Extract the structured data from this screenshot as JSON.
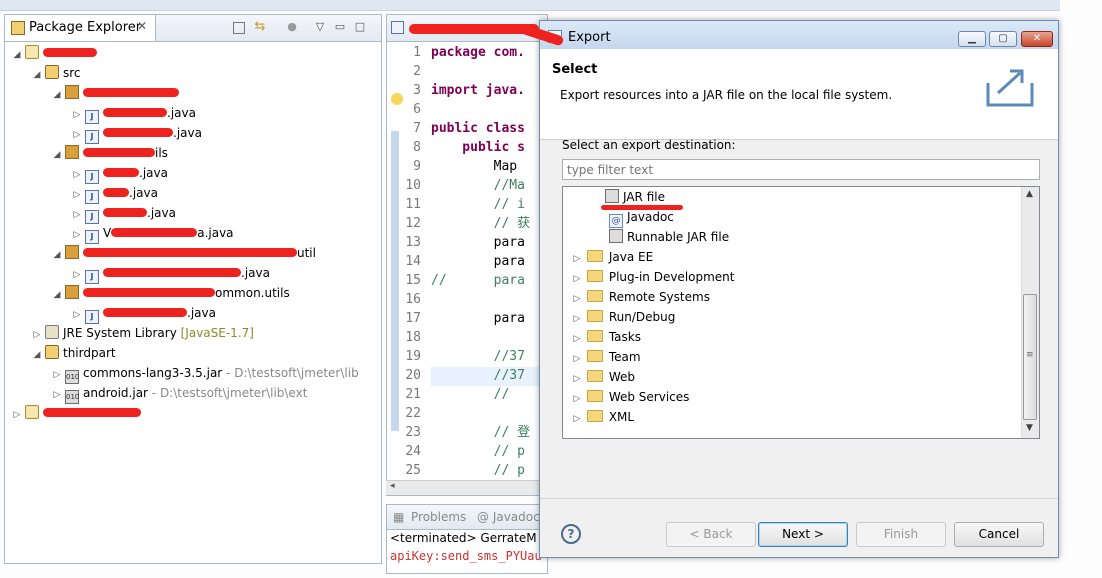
{
  "package_explorer": {
    "title": "Package Explorer",
    "src_label": "src",
    "files": {
      "f1": ".java",
      "f2": ".java",
      "f3": ".java",
      "f4": ".java",
      "f5": ".java",
      "f6_prefix": "V",
      "f6_suffix": "a.java",
      "f7": ".java",
      "f8": ".java"
    },
    "packages": {
      "p2_suffix": "ils",
      "p3_suffix": "util",
      "p4_suffix": "ommon.utils"
    },
    "jre_label": "JRE System Library",
    "jre_version": "[JavaSE-1.7]",
    "thirdpart_label": "thirdpart",
    "jar1_name": "commons-lang3-3.5.jar",
    "jar1_path": " - D:\\testsoft\\jmeter\\lib",
    "jar2_name": "android.jar",
    "jar2_path": " - D:\\testsoft\\jmeter\\lib\\ext"
  },
  "editor": {
    "lines": [
      {
        "n": "1",
        "code": "package com."
      },
      {
        "n": "2",
        "code": ""
      },
      {
        "n": "3",
        "code": "import java."
      },
      {
        "n": "6",
        "code": ""
      },
      {
        "n": "7",
        "code": "public class"
      },
      {
        "n": "8",
        "code": "    public s"
      },
      {
        "n": "9",
        "code": "        Map"
      },
      {
        "n": "10",
        "code": "        //Ma"
      },
      {
        "n": "11",
        "code": "        // i"
      },
      {
        "n": "12",
        "code": "        // 获"
      },
      {
        "n": "13",
        "code": "        para"
      },
      {
        "n": "14",
        "code": "        para"
      },
      {
        "n": "15",
        "code": "//      para"
      },
      {
        "n": "16",
        "code": ""
      },
      {
        "n": "17",
        "code": "        para"
      },
      {
        "n": "18",
        "code": ""
      },
      {
        "n": "19",
        "code": "        //37"
      },
      {
        "n": "20",
        "code": "        //37"
      },
      {
        "n": "21",
        "code": "        //"
      },
      {
        "n": "22",
        "code": ""
      },
      {
        "n": "23",
        "code": "        // 登"
      },
      {
        "n": "24",
        "code": "        // p"
      },
      {
        "n": "25",
        "code": "        // p"
      }
    ],
    "bottom_tabs": [
      "Problems",
      "@ Javadoc"
    ],
    "console_line1": "<terminated> GerrateM",
    "console_line2": "apiKey:send_sms_PYUau"
  },
  "dialog": {
    "title": "Export",
    "header_title": "Select",
    "header_desc": "Export resources into a JAR file on the local file system.",
    "select_label": "Select an export destination:",
    "filter_placeholder": "type filter text",
    "tree": {
      "jar_file": "JAR file",
      "javadoc": "Javadoc",
      "runnable_jar": "Runnable JAR file",
      "java_ee": "Java EE",
      "plugin_dev": "Plug-in Development",
      "remote_systems": "Remote Systems",
      "run_debug": "Run/Debug",
      "tasks": "Tasks",
      "team": "Team",
      "web": "Web",
      "web_services": "Web Services",
      "xml": "XML"
    },
    "buttons": {
      "help": "?",
      "back": "< Back",
      "next": "Next >",
      "finish": "Finish",
      "cancel": "Cancel"
    }
  },
  "colors": {
    "redaction": "#ee2320",
    "keyword": "#7f0055",
    "comment": "#3f7f5f"
  }
}
